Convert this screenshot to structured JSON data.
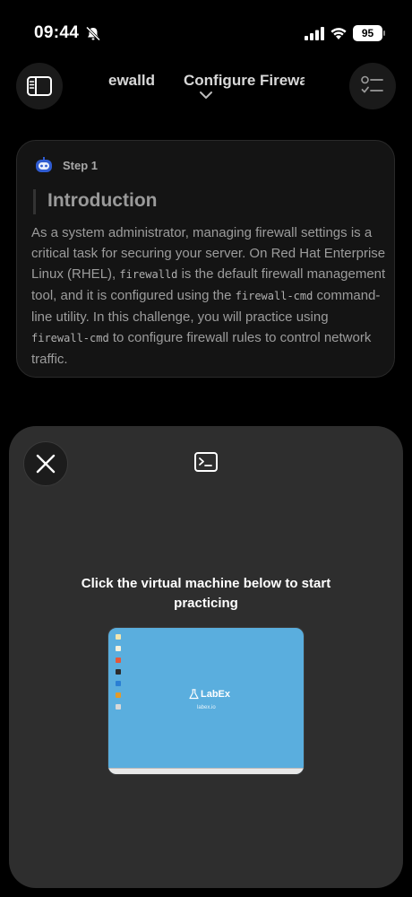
{
  "status_bar": {
    "time": "09:44",
    "battery": "95"
  },
  "nav": {
    "prev_title": "ewalld",
    "current_title": "Configure Firewa"
  },
  "step": {
    "label": "Step 1",
    "title": "Introduction",
    "body": [
      {
        "type": "text",
        "value": "As a system administrator, managing firewall settings is a critical task for securing your server. On Red Hat Enterprise Linux (RHEL), "
      },
      {
        "type": "code",
        "value": "firewalld"
      },
      {
        "type": "text",
        "value": " is the default firewall management tool, and it is configured using the "
      },
      {
        "type": "code",
        "value": "firewall-cmd"
      },
      {
        "type": "text",
        "value": " command-line utility. In this challenge, you will practice using "
      },
      {
        "type": "code",
        "value": "firewall-cmd"
      },
      {
        "type": "text",
        "value": " to configure firewall rules to control network traffic."
      }
    ]
  },
  "sheet": {
    "prompt": "Click the virtual machine below to start practicing",
    "vm": {
      "logo_text": "LabEx",
      "subtitle": "labex.io",
      "background": "#5aaede"
    }
  },
  "icons": {
    "sidebar": "sidebar-icon",
    "checklist": "checklist-icon",
    "close": "close-icon",
    "terminal": "terminal-icon",
    "robot": "robot-icon"
  }
}
